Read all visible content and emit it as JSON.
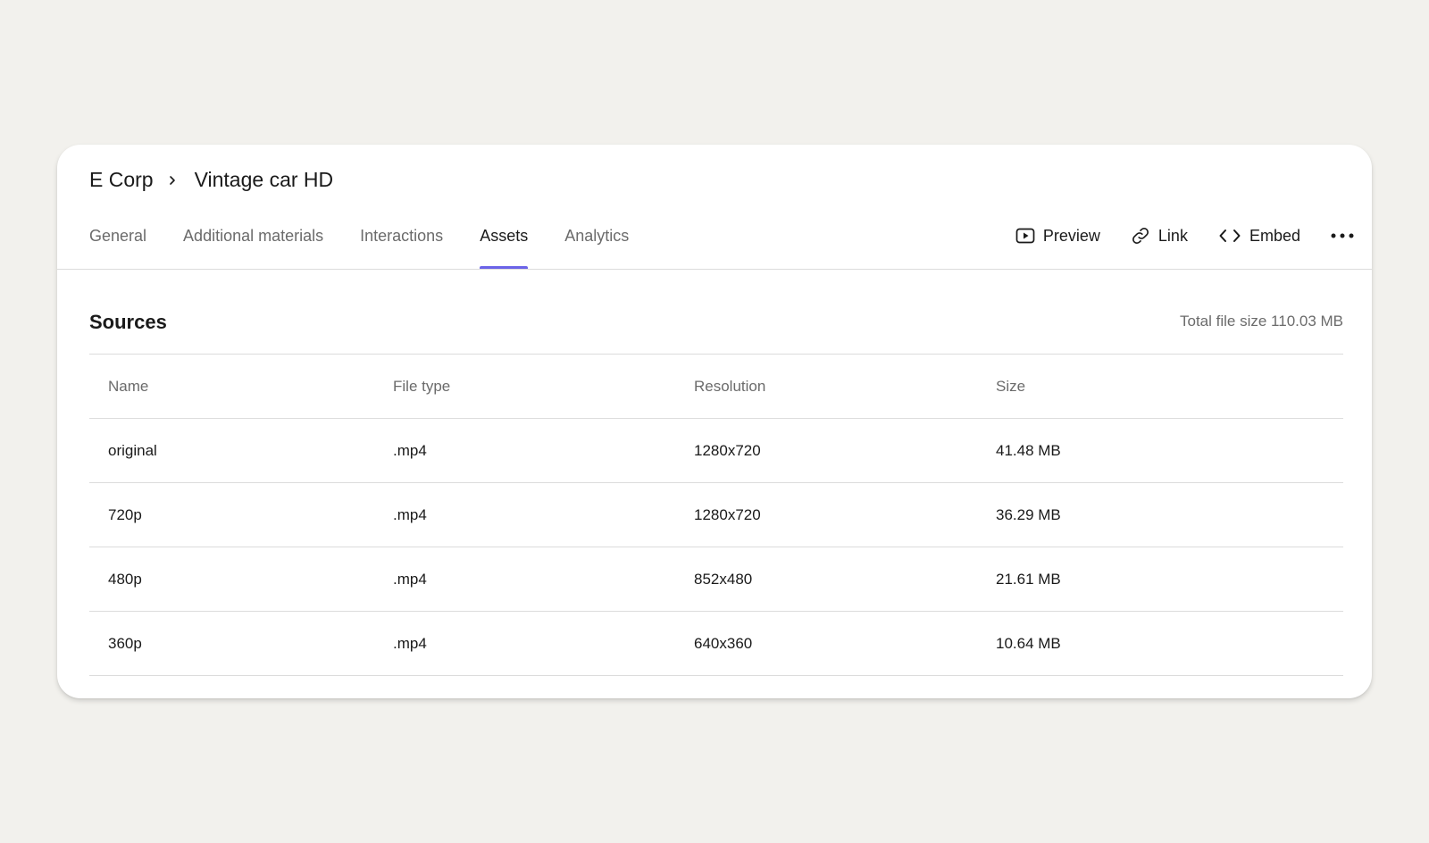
{
  "breadcrumb": {
    "parent": "E Corp",
    "current": "Vintage car HD"
  },
  "tabs": [
    {
      "label": "General",
      "active": false
    },
    {
      "label": "Additional materials",
      "active": false
    },
    {
      "label": "Interactions",
      "active": false
    },
    {
      "label": "Assets",
      "active": true
    },
    {
      "label": "Analytics",
      "active": false
    }
  ],
  "actions": {
    "preview": {
      "label": "Preview",
      "icon": "play-window-icon"
    },
    "link": {
      "label": "Link",
      "icon": "link-icon"
    },
    "embed": {
      "label": "Embed",
      "icon": "code-icon"
    },
    "more": {
      "icon": "more-horizontal-icon"
    }
  },
  "sources": {
    "title": "Sources",
    "total": "Total file size 110.03 MB",
    "columns": [
      "Name",
      "File type",
      "Resolution",
      "Size"
    ],
    "rows": [
      [
        "original",
        ".mp4",
        "1280x720",
        "41.48 MB"
      ],
      [
        "720p",
        ".mp4",
        "1280x720",
        "36.29 MB"
      ],
      [
        "480p",
        ".mp4",
        "852x480",
        "21.61 MB"
      ],
      [
        "360p",
        ".mp4",
        "640x360",
        "10.64 MB"
      ]
    ]
  },
  "colors": {
    "accent": "#6b63e8",
    "background": "#f2f1ed",
    "card": "#ffffff"
  }
}
